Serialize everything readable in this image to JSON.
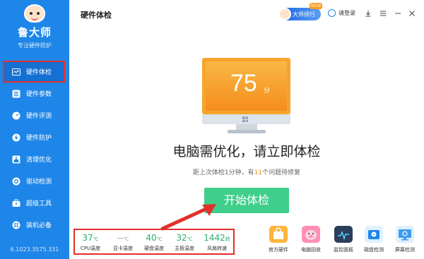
{
  "sidebar": {
    "brand": "鲁大师",
    "slogan": "专注硬件防护",
    "items": [
      {
        "label": "硬件体检",
        "icon": "pulse-icon"
      },
      {
        "label": "硬件参数",
        "icon": "list-icon"
      },
      {
        "label": "硬件评测",
        "icon": "gauge-icon"
      },
      {
        "label": "硬件防护",
        "icon": "bolt-shield-icon"
      },
      {
        "label": "清理优化",
        "icon": "broom-icon"
      },
      {
        "label": "驱动检测",
        "icon": "gear-icon"
      },
      {
        "label": "超级工具",
        "icon": "toolbox-icon"
      },
      {
        "label": "装机必备",
        "icon": "apps-icon"
      }
    ],
    "version": "6.1023.3575.331"
  },
  "header": {
    "title": "硬件体检",
    "rank_label": "大师排行",
    "new_tag": "NEW",
    "login_label": "请登录"
  },
  "main": {
    "score": "75",
    "score_unit": "分",
    "headline": "电脑需优化，请立即体检",
    "subline_prefix": "距上次体检1分钟，有",
    "issue_count": "11",
    "subline_suffix": "个问题待修复",
    "start_button": "开始体检"
  },
  "sensors": [
    {
      "value": "37",
      "unit": "℃",
      "label": "CPU温度"
    },
    {
      "value": "--",
      "unit": "℃",
      "label": "显卡温度"
    },
    {
      "value": "40",
      "unit": "℃",
      "label": "硬盘温度"
    },
    {
      "value": "32",
      "unit": "℃",
      "label": "主板温度"
    },
    {
      "value": "1442",
      "unit": "转",
      "label": "风扇转速"
    }
  ],
  "tools": [
    {
      "label": "官方硬件",
      "icon": "store-icon"
    },
    {
      "label": "电脑回收",
      "icon": "pig-icon"
    },
    {
      "label": "监控面板",
      "icon": "monitor-panel-icon"
    },
    {
      "label": "磁盘检测",
      "icon": "disk-icon"
    },
    {
      "label": "屏幕检测",
      "icon": "screen-icon"
    }
  ],
  "colors": {
    "sidebar": "#1e86e8",
    "accent_green": "#3fcf8b",
    "score_orange": "#f7a42c",
    "highlight_red": "#e0302a"
  }
}
